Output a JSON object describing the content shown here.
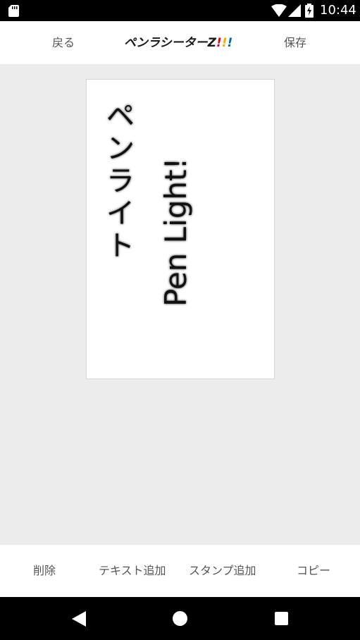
{
  "status_bar": {
    "time": "10:44",
    "icons": [
      "sd-card-icon",
      "wifi-icon",
      "cell-signal-icon",
      "battery-charging-icon"
    ]
  },
  "header": {
    "back_label": "戻る",
    "logo_text": "ペンラシーターZ",
    "logo_suffix": "!!!",
    "save_label": "保存",
    "logo_colors": [
      "#e60012",
      "#f5a800",
      "#0068b7"
    ]
  },
  "canvas": {
    "text_japanese": "ペンライト",
    "text_japanese_chars": [
      "ペ",
      "ン",
      "ラ",
      "イ",
      "ト"
    ],
    "text_english": "Pen Light!"
  },
  "toolbar": {
    "delete_label": "削除",
    "add_text_label": "テキスト追加",
    "add_stamp_label": "スタンプ追加",
    "copy_label": "コピー"
  },
  "nav_bar": {
    "icons": [
      "back-triangle-icon",
      "home-circle-icon",
      "recents-square-icon"
    ]
  }
}
